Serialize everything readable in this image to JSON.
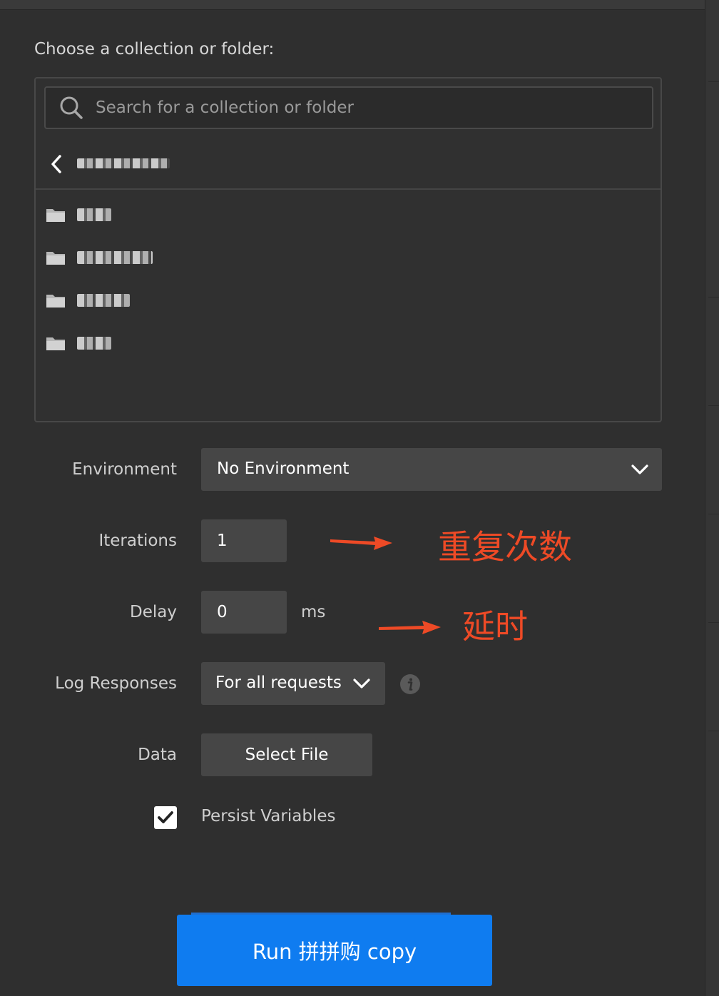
{
  "panel": {
    "choose_label": "Choose a collection or folder:",
    "search_placeholder": "Search for a collection or folder",
    "breadcrumb_name": "(blurred)",
    "folders": [
      "(blurred)",
      "(blurred)",
      "(blurred)",
      "(blurred)"
    ]
  },
  "form": {
    "environment_label": "Environment",
    "environment_value": "No Environment",
    "iterations_label": "Iterations",
    "iterations_value": "1",
    "delay_label": "Delay",
    "delay_value": "0",
    "delay_unit": "ms",
    "log_label": "Log Responses",
    "log_value": "For all requests",
    "data_label": "Data",
    "select_file_label": "Select File",
    "persist_label": "Persist Variables",
    "persist_checked": true,
    "run_label": "Run 拼拼购 copy"
  },
  "annotations": {
    "iterations_note": "重复次数",
    "delay_note": "延时"
  },
  "colors": {
    "background": "#2f2f2f",
    "input_bg": "#464646",
    "run_button": "#0f7cf0",
    "annotation": "#ee4a26"
  },
  "icons": [
    "search-icon",
    "chevron-left-icon",
    "folder-icon",
    "chevron-down-icon",
    "info-icon",
    "checkmark-icon",
    "arrow-right-icon"
  ]
}
